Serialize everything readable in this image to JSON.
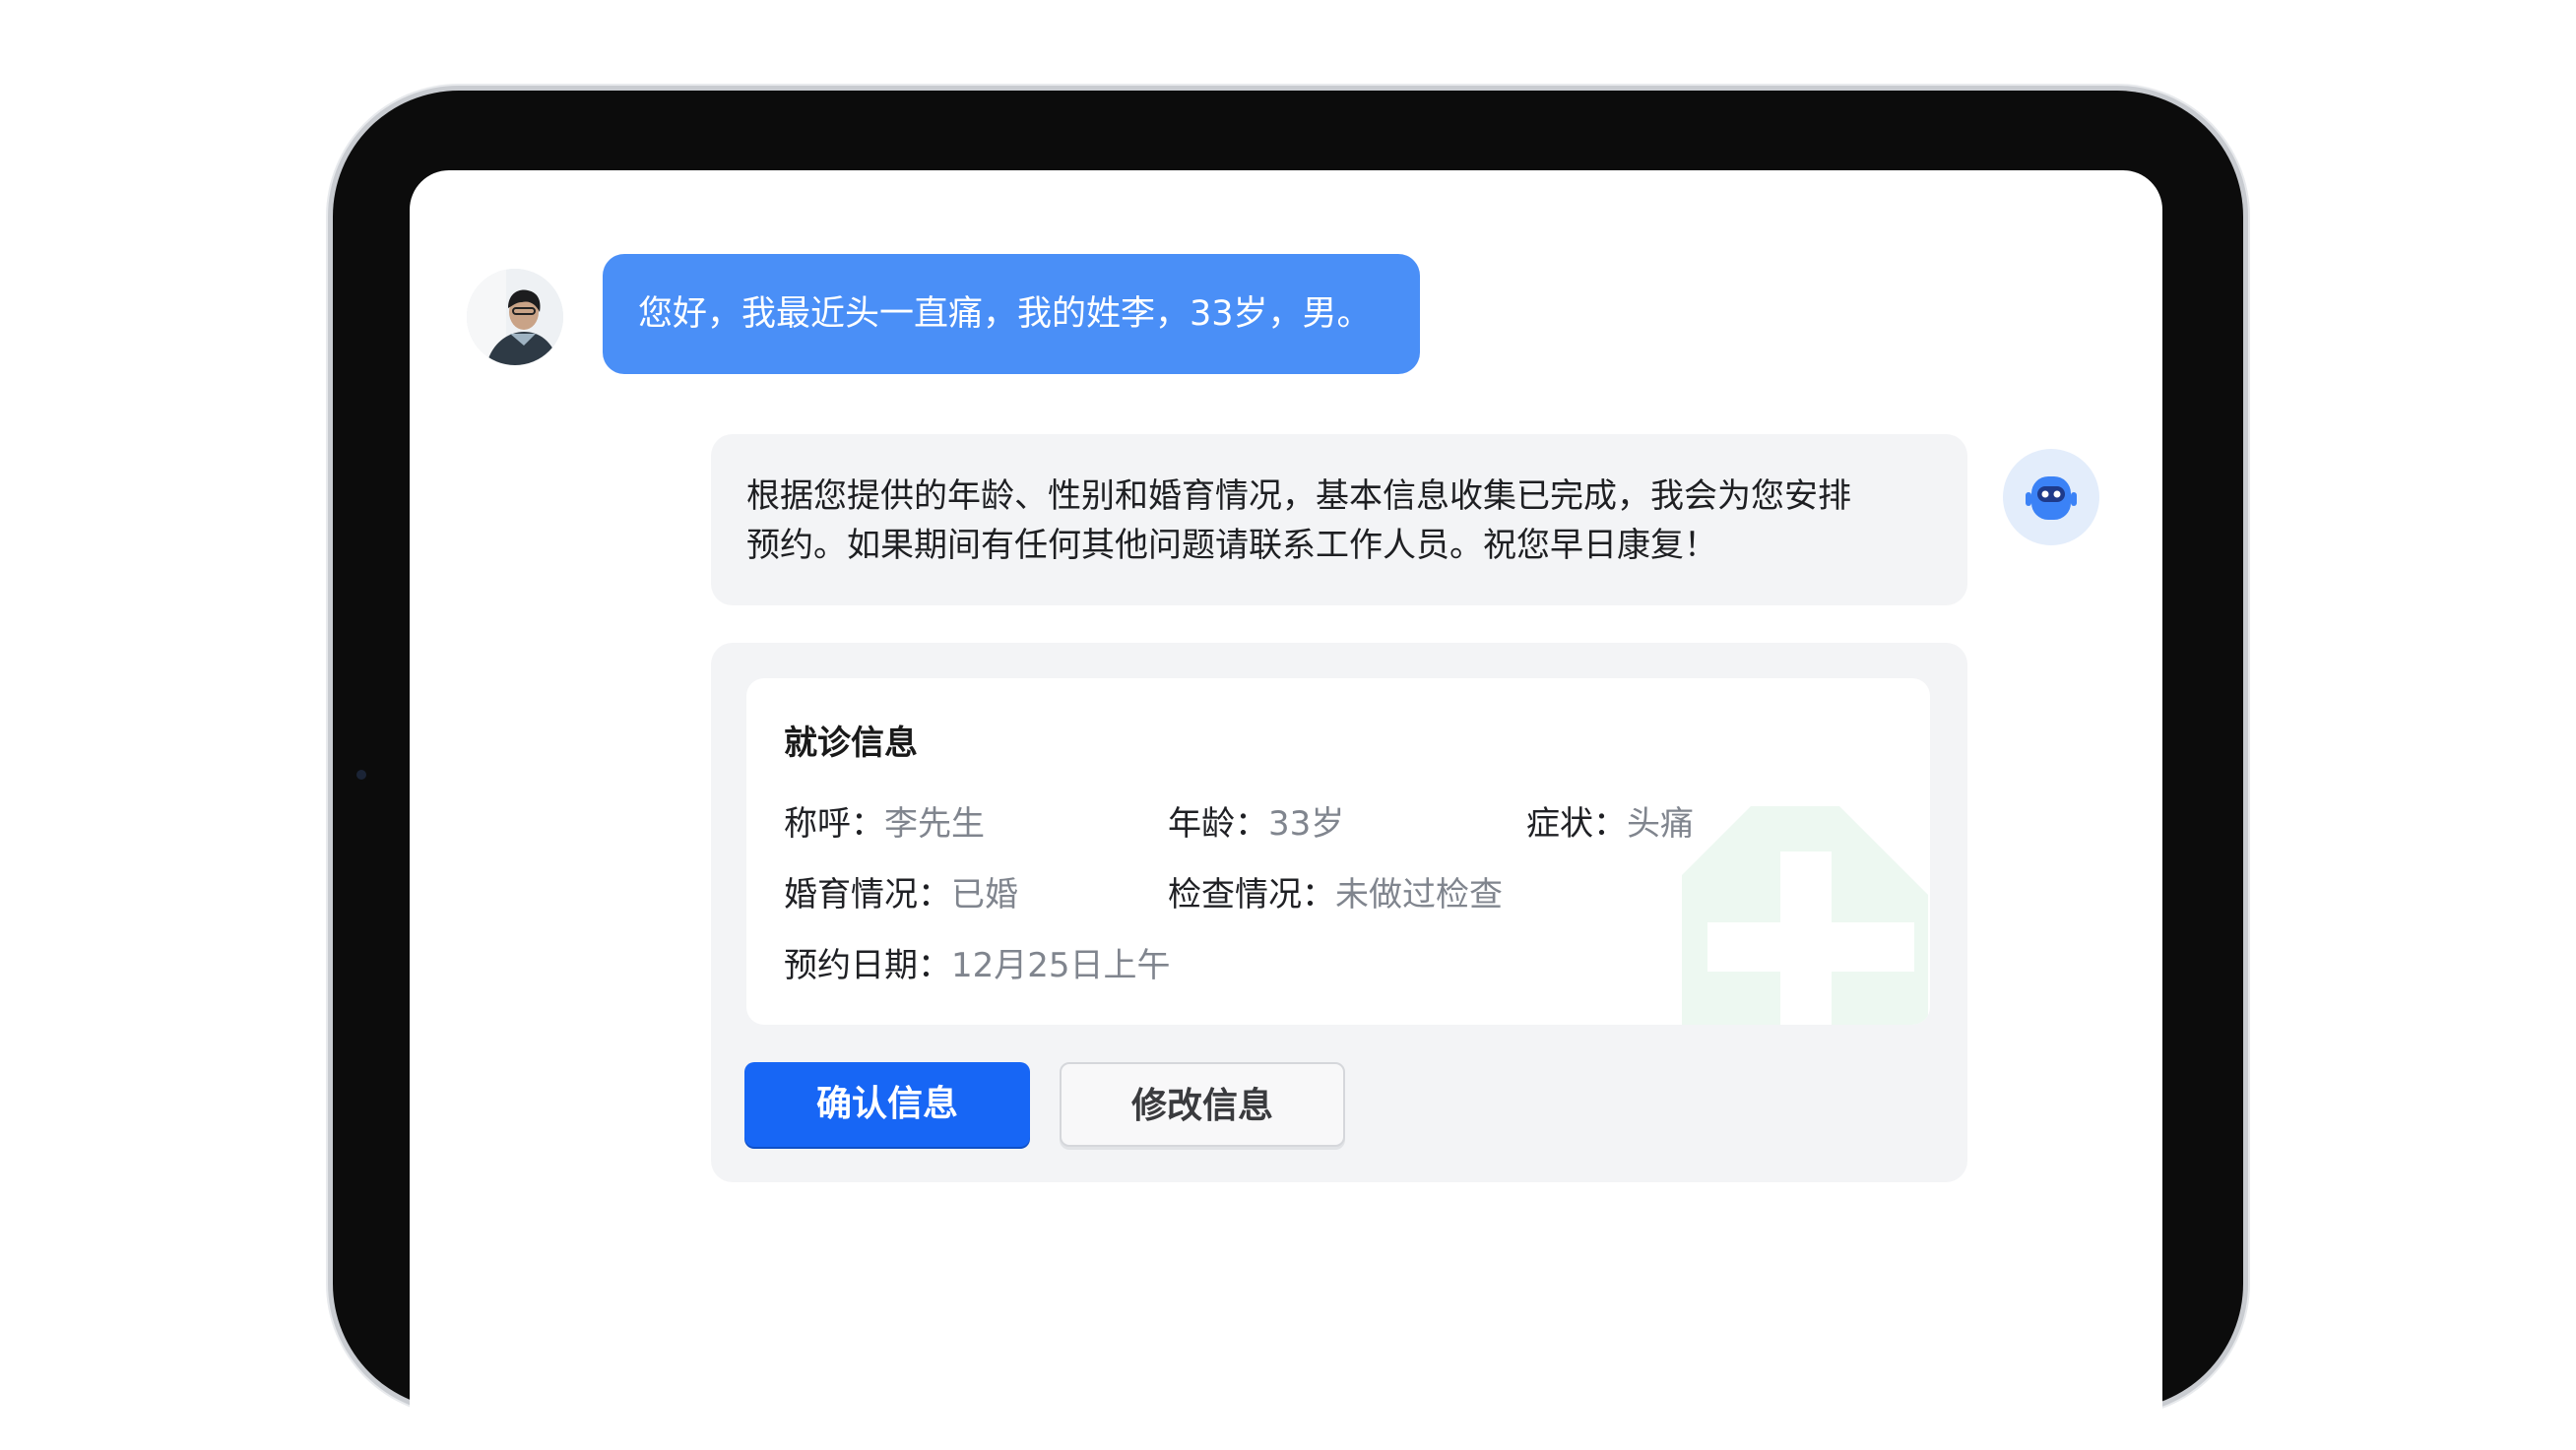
{
  "user_message": {
    "text": "您好，我最近头一直痛，我的姓李，33岁，男。"
  },
  "bot_message": {
    "lines": [
      "根据您提供的年龄、性别和婚育情况，基本信息收集已完成，我会为您安排",
      "预约。如果期间有任何其他问题请联系工作人员。祝您早日康复！"
    ]
  },
  "visit_card": {
    "title": "就诊信息",
    "fields": [
      {
        "label": "称呼：",
        "value": "李先生"
      },
      {
        "label": "年龄：",
        "value": "33岁"
      },
      {
        "label": "症状：",
        "value": "头痛"
      },
      {
        "label": "婚育情况：",
        "value": "已婚"
      },
      {
        "label": "检查情况：",
        "value": "未做过检查"
      },
      {
        "label": "预约日期：",
        "value": "12月25日上午"
      }
    ],
    "confirm_label": "确认信息",
    "edit_label": "修改信息"
  },
  "colors": {
    "user_bubble": "#4a8ff7",
    "primary_button": "#1766f5",
    "bot_icon": "#3b82f6",
    "watermark": "#eaf6ee"
  },
  "icons": {
    "user_avatar": "user-photo-avatar",
    "bot_avatar": "robot-icon",
    "watermark": "medical-cross-icon"
  }
}
